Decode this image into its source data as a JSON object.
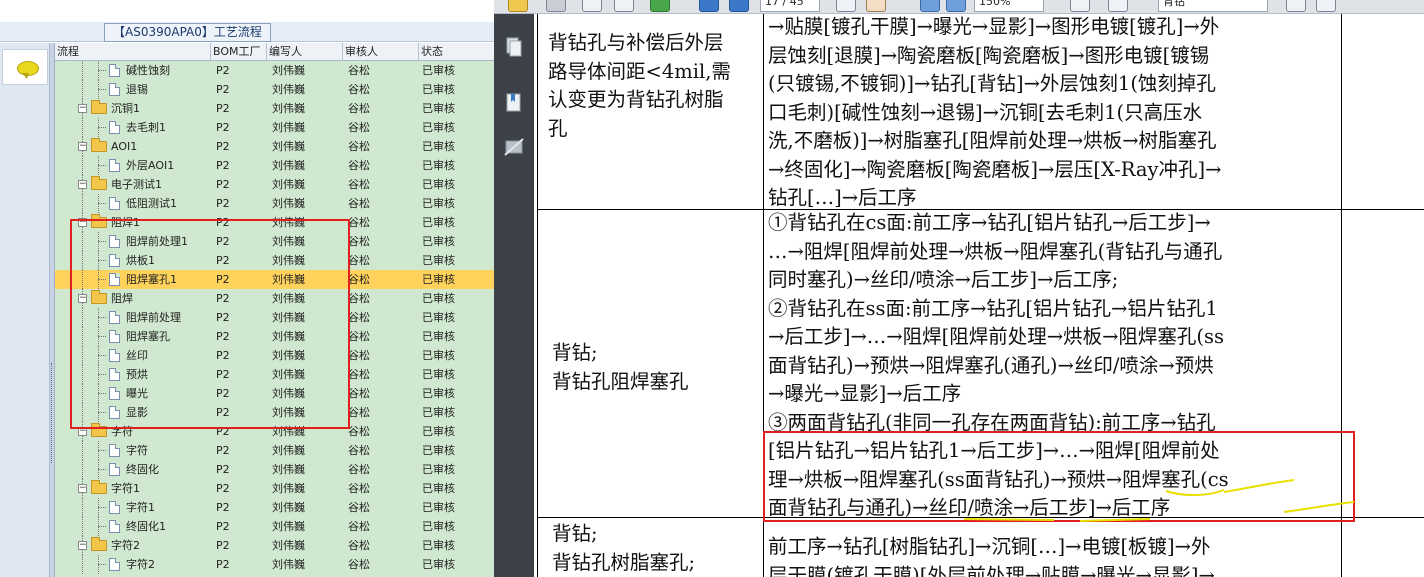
{
  "left_app": {
    "title": "【AS0390APA0】工艺流程",
    "grid": {
      "columns": [
        "流程",
        "BOM工厂",
        "编写人",
        "审核人",
        "状态"
      ],
      "rows": [
        {
          "level": 2,
          "type": "doc",
          "name": "碱性蚀刻",
          "bom": "P2",
          "writer": "刘伟巍",
          "reviewer": "谷松",
          "status": "已审核"
        },
        {
          "level": 2,
          "type": "doc",
          "name": "退锡",
          "bom": "P2",
          "writer": "刘伟巍",
          "reviewer": "谷松",
          "status": "已审核"
        },
        {
          "level": 1,
          "type": "folder",
          "name": "沉铜1",
          "bom": "P2",
          "writer": "刘伟巍",
          "reviewer": "谷松",
          "status": "已审核"
        },
        {
          "level": 2,
          "type": "doc",
          "name": "去毛刺1",
          "bom": "P2",
          "writer": "刘伟巍",
          "reviewer": "谷松",
          "status": "已审核"
        },
        {
          "level": 1,
          "type": "folder",
          "name": "AOI1",
          "bom": "P2",
          "writer": "刘伟巍",
          "reviewer": "谷松",
          "status": "已审核"
        },
        {
          "level": 2,
          "type": "doc",
          "name": "外层AOI1",
          "bom": "P2",
          "writer": "刘伟巍",
          "reviewer": "谷松",
          "status": "已审核"
        },
        {
          "level": 1,
          "type": "folder",
          "name": "电子测试1",
          "bom": "P2",
          "writer": "刘伟巍",
          "reviewer": "谷松",
          "status": "已审核"
        },
        {
          "level": 2,
          "type": "doc",
          "name": "低阻测试1",
          "bom": "P2",
          "writer": "刘伟巍",
          "reviewer": "谷松",
          "status": "已审核"
        },
        {
          "level": 1,
          "type": "folder",
          "name": "阻焊1",
          "bom": "P2",
          "writer": "刘伟巍",
          "reviewer": "谷松",
          "status": "已审核"
        },
        {
          "level": 2,
          "type": "doc",
          "name": "阻焊前处理1",
          "bom": "P2",
          "writer": "刘伟巍",
          "reviewer": "谷松",
          "status": "已审核"
        },
        {
          "level": 2,
          "type": "doc",
          "name": "烘板1",
          "bom": "P2",
          "writer": "刘伟巍",
          "reviewer": "谷松",
          "status": "已审核"
        },
        {
          "level": 2,
          "type": "doc",
          "name": "阻焊塞孔1",
          "bom": "P2",
          "writer": "刘伟巍",
          "reviewer": "谷松",
          "status": "已审核",
          "selected": true
        },
        {
          "level": 1,
          "type": "folder",
          "name": "阻焊",
          "bom": "P2",
          "writer": "刘伟巍",
          "reviewer": "谷松",
          "status": "已审核"
        },
        {
          "level": 2,
          "type": "doc",
          "name": "阻焊前处理",
          "bom": "P2",
          "writer": "刘伟巍",
          "reviewer": "谷松",
          "status": "已审核"
        },
        {
          "level": 2,
          "type": "doc",
          "name": "阻焊塞孔",
          "bom": "P2",
          "writer": "刘伟巍",
          "reviewer": "谷松",
          "status": "已审核"
        },
        {
          "level": 2,
          "type": "doc",
          "name": "丝印",
          "bom": "P2",
          "writer": "刘伟巍",
          "reviewer": "谷松",
          "status": "已审核"
        },
        {
          "level": 2,
          "type": "doc",
          "name": "预烘",
          "bom": "P2",
          "writer": "刘伟巍",
          "reviewer": "谷松",
          "status": "已审核"
        },
        {
          "level": 2,
          "type": "doc",
          "name": "曝光",
          "bom": "P2",
          "writer": "刘伟巍",
          "reviewer": "谷松",
          "status": "已审核"
        },
        {
          "level": 2,
          "type": "doc",
          "name": "显影",
          "bom": "P2",
          "writer": "刘伟巍",
          "reviewer": "谷松",
          "status": "已审核"
        },
        {
          "level": 1,
          "type": "folder",
          "name": "字符",
          "bom": "P2",
          "writer": "刘伟巍",
          "reviewer": "谷松",
          "status": "已审核"
        },
        {
          "level": 2,
          "type": "doc",
          "name": "字符",
          "bom": "P2",
          "writer": "刘伟巍",
          "reviewer": "谷松",
          "status": "已审核"
        },
        {
          "level": 2,
          "type": "doc",
          "name": "终固化",
          "bom": "P2",
          "writer": "刘伟巍",
          "reviewer": "谷松",
          "status": "已审核"
        },
        {
          "level": 1,
          "type": "folder",
          "name": "字符1",
          "bom": "P2",
          "writer": "刘伟巍",
          "reviewer": "谷松",
          "status": "已审核"
        },
        {
          "level": 2,
          "type": "doc",
          "name": "字符1",
          "bom": "P2",
          "writer": "刘伟巍",
          "reviewer": "谷松",
          "status": "已审核"
        },
        {
          "level": 2,
          "type": "doc",
          "name": "终固化1",
          "bom": "P2",
          "writer": "刘伟巍",
          "reviewer": "谷松",
          "status": "已审核"
        },
        {
          "level": 1,
          "type": "folder",
          "name": "字符2",
          "bom": "P2",
          "writer": "刘伟巍",
          "reviewer": "谷松",
          "status": "已审核"
        },
        {
          "level": 2,
          "type": "doc",
          "name": "字符2",
          "bom": "P2",
          "writer": "刘伟巍",
          "reviewer": "谷松",
          "status": "已审核"
        }
      ]
    }
  },
  "pdf_viewer": {
    "toolbar": {
      "page_field": "17 / 45",
      "zoom_field": "150%",
      "search_field": "背钻"
    },
    "document": {
      "row1": {
        "left": [
          "背钻孔与补偿后外层",
          "路导体间距<4mil,需",
          "认变更为背钻孔树脂",
          "孔"
        ],
        "right": [
          "→贴膜[镀孔干膜]→曝光→显影]→图形电镀[镀孔]→外",
          "层蚀刻[退膜]→陶瓷磨板[陶瓷磨板]→图形电镀[镀锡",
          "(只镀锡,不镀铜)]→钻孔[背钻]→外层蚀刻1(蚀刻掉孔",
          "口毛刺)[碱性蚀刻→退锡]→沉铜[去毛刺1(只高压水",
          "洗,不磨板)]→树脂塞孔[阻焊前处理→烘板→树脂塞孔",
          "→终固化]→陶瓷磨板[陶瓷磨板]→层压[X-Ray冲孔]→",
          "钻孔[…]→后工序"
        ]
      },
      "row2": {
        "left": [
          "背钻;",
          "背钻孔阻焊塞孔"
        ],
        "right": [
          "①背钻孔在cs面:前工序→钻孔[铝片钻孔→后工步]→",
          "…→阻焊[阻焊前处理→烘板→阻焊塞孔(背钻孔与通孔",
          "同时塞孔)→丝印/喷涂→后工步]→后工序;",
          "②背钻孔在ss面:前工序→钻孔[铝片钻孔→铝片钻孔1",
          "→后工步]→…→阻焊[阻焊前处理→烘板→阻焊塞孔(ss",
          "面背钻孔)→预烘→阻焊塞孔(通孔)→丝印/喷涂→预烘",
          "→曝光→显影]→后工序",
          "③两面背钻孔(非同一孔存在两面背钻):前工序→钻孔",
          "[铝片钻孔→铝片钻孔1→后工步]→…→阻焊[阻焊前处",
          "理→烘板→阻焊塞孔(ss面背钻孔)→预烘→阻焊塞孔(cs",
          "面背钻孔与通孔)→丝印/喷涂→后工步]→后工序"
        ]
      },
      "row3": {
        "left": [
          "背钻;",
          "背钻孔树脂塞孔;"
        ],
        "right": [
          "前工序→钻孔[树脂钻孔]→沉铜[…]→电镀[板镀]→外",
          "层干膜(镀孔干膜)[外层前处理→贴膜→曝光→显影]→"
        ]
      }
    }
  },
  "colors": {
    "grid_bg": "#cfe8cf",
    "selected_row": "#ffd25c",
    "highlight_box": "#e02020",
    "annotation": "#e8e000"
  }
}
